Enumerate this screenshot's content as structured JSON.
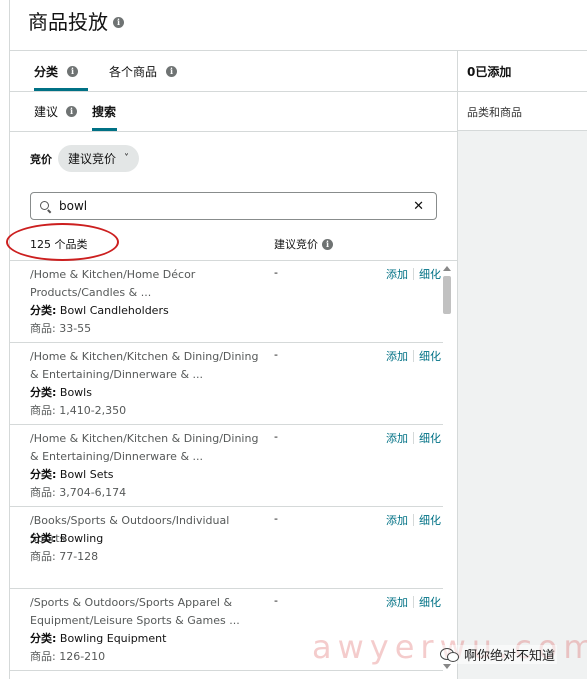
{
  "header": {
    "title": "商品投放"
  },
  "main_tabs": [
    {
      "label": "分类",
      "active": true
    },
    {
      "label": "各个商品",
      "active": false
    }
  ],
  "right_panel": {
    "added_label": "0已添加",
    "sub_label": "品类和商品"
  },
  "sub_tabs": [
    {
      "label": "建议",
      "active": false
    },
    {
      "label": "搜索",
      "active": true
    }
  ],
  "bid": {
    "label": "竞价",
    "selected": "建议竞价"
  },
  "search": {
    "value": "bowl"
  },
  "results": {
    "count_label": "125 个品类",
    "bid_column": "建议竞价"
  },
  "rows": [
    {
      "path": "/Home & Kitchen/Home Décor Products/Candles & ...",
      "category_label": "分类:",
      "category": "Bowl Candleholders",
      "count_label": "商品:",
      "count": "33-55",
      "bid": "-",
      "add": "添加",
      "refine": "细化"
    },
    {
      "path": "/Home & Kitchen/Kitchen & Dining/Dining & Entertaining/Dinnerware & ...",
      "category_label": "分类:",
      "category": "Bowls",
      "count_label": "商品:",
      "count": "1,410-2,350",
      "bid": "-",
      "add": "添加",
      "refine": "细化"
    },
    {
      "path": "/Home & Kitchen/Kitchen & Dining/Dining & Entertaining/Dinnerware & ...",
      "category_label": "分类:",
      "category": "Bowl Sets",
      "count_label": "商品:",
      "count": "3,704-6,174",
      "bid": "-",
      "add": "添加",
      "refine": "细化"
    },
    {
      "path": "/Books/Sports & Outdoors/Individual Sports",
      "category_label": "分类:",
      "category": "Bowling",
      "count_label": "商品:",
      "count": "77-128",
      "bid": "-",
      "add": "添加",
      "refine": "细化"
    },
    {
      "path": "/Sports & Outdoors/Sports Apparel & Equipment/Leisure Sports & Games ...",
      "category_label": "分类:",
      "category": "Bowling Equipment",
      "count_label": "商品:",
      "count": "126-210",
      "bid": "-",
      "add": "添加",
      "refine": "细化"
    }
  ],
  "watermark": {
    "text": "awyerwu.com",
    "wechat_text": "啊你绝对不知道"
  },
  "colors": {
    "accent": "#007185",
    "annotation": "#cc1f1f"
  }
}
